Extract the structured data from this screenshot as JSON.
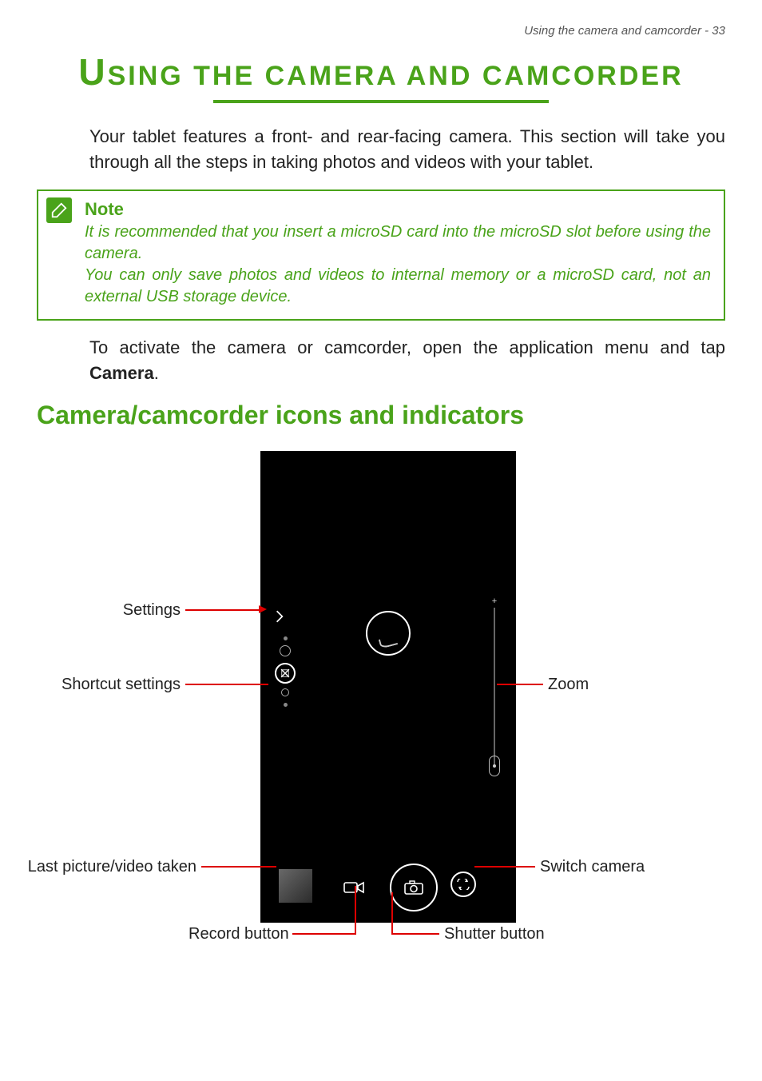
{
  "page": {
    "running_head": "Using the camera and camcorder - 33",
    "title_first": "U",
    "title_rest": "SING THE CAMERA AND CAMCORDER"
  },
  "intro": {
    "p1": "Your tablet features a front- and rear-facing camera. This section will take you through all the steps in taking photos and videos with your tablet."
  },
  "note": {
    "title": "Note",
    "line1": "It is recommended that you insert a microSD card into the microSD slot before using the camera.",
    "line2": "You can only save photos and videos to internal memory or a microSD card, not an external USB storage device."
  },
  "after_note": {
    "p1_pre": "To activate the camera or camcorder, open the application menu and tap ",
    "p1_bold": "Camera",
    "p1_post": "."
  },
  "h2": "Camera/camcorder icons and indicators",
  "callouts": {
    "settings": "Settings",
    "shortcut": "Shortcut settings",
    "last": "Last picture/video taken",
    "record": "Record button",
    "zoom": "Zoom",
    "switch": "Switch camera",
    "shutter": "Shutter button"
  }
}
